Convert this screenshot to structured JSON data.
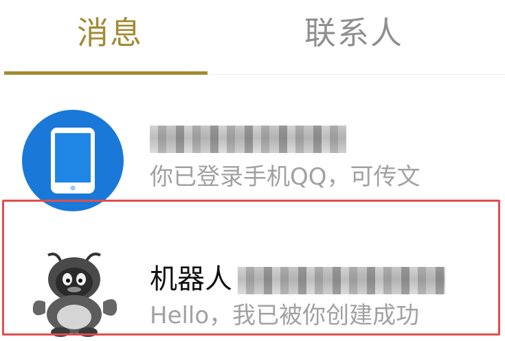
{
  "tabs": {
    "messages_label": "消息",
    "contacts_label": "联系人",
    "active": "消息"
  },
  "conversations": [
    {
      "title": "",
      "preview": "你已登录手机QQ，可传文",
      "avatar": "tablet-icon"
    },
    {
      "title": "机器人",
      "preview": "Hello，我已被你创建成功",
      "avatar": "qq-penguin-robot-avatar"
    }
  ],
  "colors": {
    "accent": "#a38a33",
    "inactive_tab": "#8f8f8f",
    "highlight": "#e24d4d",
    "device_avatar_bg": "#1a79d8",
    "preview_text": "#a1a1a1"
  }
}
